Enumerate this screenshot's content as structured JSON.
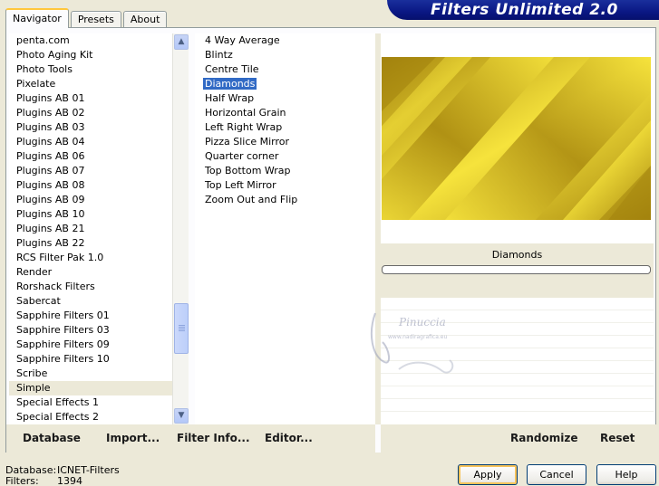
{
  "tabs": [
    {
      "label": "Navigator",
      "active": true
    },
    {
      "label": "Presets",
      "active": false
    },
    {
      "label": "About",
      "active": false
    }
  ],
  "app_title": "Filters Unlimited 2.0",
  "categories": [
    "penta.com",
    "Photo Aging Kit",
    "Photo Tools",
    "Pixelate",
    "Plugins AB 01",
    "Plugins AB 02",
    "Plugins AB 03",
    "Plugins AB 04",
    "Plugins AB 06",
    "Plugins AB 07",
    "Plugins AB 08",
    "Plugins AB 09",
    "Plugins AB 10",
    "Plugins AB 21",
    "Plugins AB 22",
    "RCS Filter Pak 1.0",
    "Render",
    "Rorshack Filters",
    "Sabercat",
    "Sapphire Filters 01",
    "Sapphire Filters 03",
    "Sapphire Filters 09",
    "Sapphire Filters 10",
    "Scribe",
    "Simple",
    "Special Effects 1",
    "Special Effects 2"
  ],
  "selected_category": "Simple",
  "filters": [
    "4 Way Average",
    "Blintz",
    "Centre Tile",
    "Diamonds",
    "Half Wrap",
    "Horizontal Grain",
    "Left Right Wrap",
    "Pizza Slice Mirror",
    "Quarter corner",
    "Top Bottom Wrap",
    "Top Left Mirror",
    "Zoom Out and Flip"
  ],
  "selected_filter": "Diamonds",
  "preview": {
    "filter_name": "Diamonds",
    "colors": {
      "light": "#f6e33c",
      "dark": "#a8880f"
    }
  },
  "toolbar": {
    "database": "Database",
    "import": "Import...",
    "filter_info": "Filter Info...",
    "editor": "Editor...",
    "randomize": "Randomize",
    "reset": "Reset"
  },
  "info": {
    "database_label": "Database:",
    "database_value": "ICNET-Filters",
    "filters_label": "Filters:",
    "filters_value": "1394"
  },
  "buttons": {
    "apply": "Apply",
    "cancel": "Cancel",
    "help": "Help"
  },
  "watermark": {
    "name": "Pinuccia",
    "site": "www.nadiragrafica.eu"
  }
}
